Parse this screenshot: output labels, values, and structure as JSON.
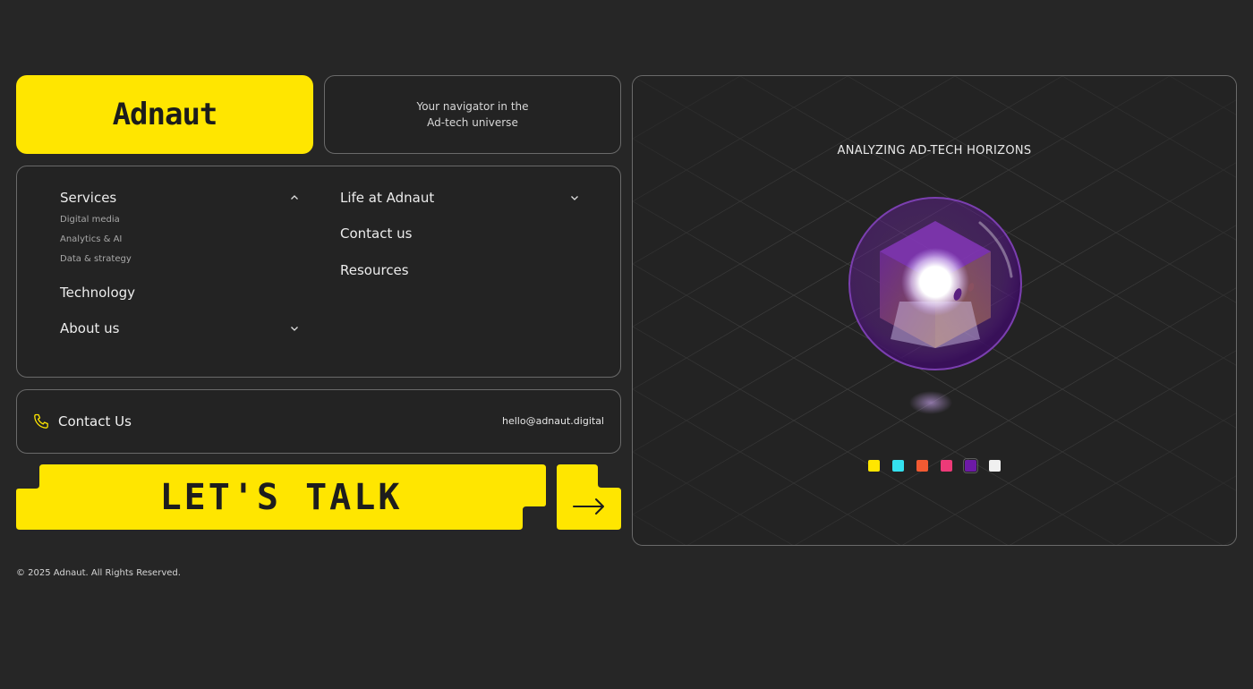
{
  "brand": {
    "logo_text": "Adnaut",
    "accent": "#ffe600"
  },
  "tagline": {
    "line1": "Your navigator in the",
    "line2": "Ad-tech universe"
  },
  "nav": {
    "left": {
      "services": {
        "label": "Services",
        "icon": "chevron-up-icon",
        "sub": [
          "Digital media",
          "Analytics & AI",
          "Data & strategy"
        ]
      },
      "technology": {
        "label": "Technology"
      },
      "about": {
        "label": "About us",
        "icon": "chevron-down-icon"
      }
    },
    "right": {
      "life": {
        "label": "Life at Adnaut",
        "icon": "chevron-down-icon"
      },
      "contact": {
        "label": "Contact us"
      },
      "resources": {
        "label": "Resources"
      }
    }
  },
  "contact_bar": {
    "label": "Contact Us",
    "icon": "phone-icon",
    "email": "hello@adnaut.digital"
  },
  "cta": {
    "label": "LET'S TALK",
    "arrow_icon": "arrow-right-icon"
  },
  "visual": {
    "title": "ANALYZING AD-TECH HORIZONS",
    "swatches": [
      {
        "name": "yellow",
        "color": "#ffe600",
        "selected": false
      },
      {
        "name": "cyan",
        "color": "#34e1ef",
        "selected": false
      },
      {
        "name": "orange",
        "color": "#f25a32",
        "selected": false
      },
      {
        "name": "pink",
        "color": "#ec3a78",
        "selected": false
      },
      {
        "name": "purple",
        "color": "#6d1aa6",
        "selected": true
      },
      {
        "name": "white",
        "color": "#f0f0f0",
        "selected": false
      }
    ]
  },
  "footer": {
    "copyright": "© 2025 Adnaut. All Rights Reserved."
  }
}
